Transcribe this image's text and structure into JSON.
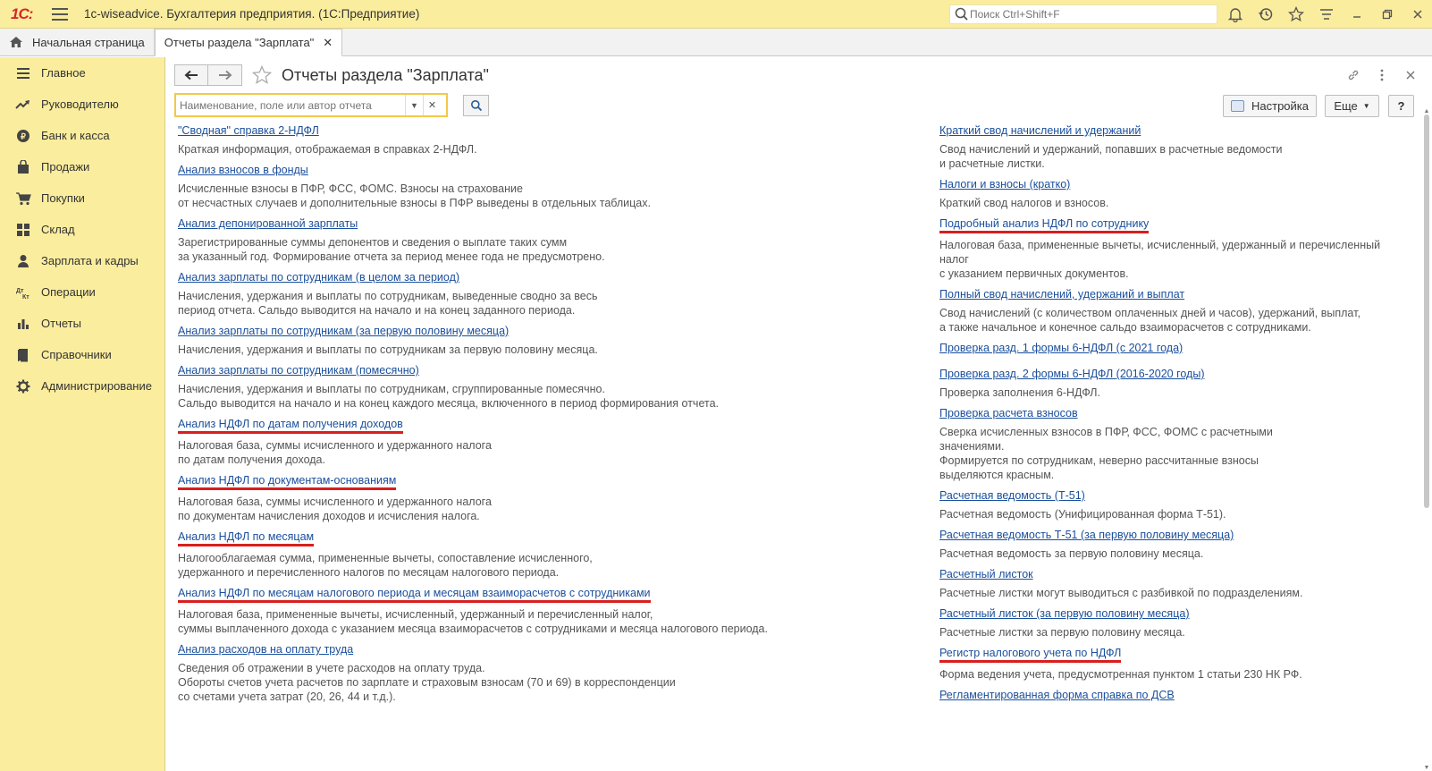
{
  "window": {
    "logo": "1С:",
    "title": "1c-wiseadvice. Бухгалтерия предприятия. (1С:Предприятие)",
    "search_placeholder": "Поиск Ctrl+Shift+F"
  },
  "tabs": [
    {
      "label": "Начальная страница"
    },
    {
      "label": "Отчеты раздела \"Зарплата\""
    }
  ],
  "sidebar": {
    "items": [
      {
        "label": "Главное",
        "icon": "list-icon"
      },
      {
        "label": "Руководителю",
        "icon": "trend-icon"
      },
      {
        "label": "Банк и касса",
        "icon": "coin-icon"
      },
      {
        "label": "Продажи",
        "icon": "bag-icon"
      },
      {
        "label": "Покупки",
        "icon": "cart-icon"
      },
      {
        "label": "Склад",
        "icon": "grid-icon"
      },
      {
        "label": "Зарплата и кадры",
        "icon": "person-icon"
      },
      {
        "label": "Операции",
        "icon": "dt-kt-icon"
      },
      {
        "label": "Отчеты",
        "icon": "bar-chart-icon"
      },
      {
        "label": "Справочники",
        "icon": "book-icon"
      },
      {
        "label": "Администрирование",
        "icon": "gear-icon"
      }
    ]
  },
  "page": {
    "title": "Отчеты раздела \"Зарплата\"",
    "filter_placeholder": "Наименование, поле или автор отчета",
    "settings_label": "Настройка",
    "more_label": "Еще",
    "help_label": "?"
  },
  "reports_left": [
    {
      "name": "\"Сводная\" справка 2-НДФЛ",
      "desc": [
        "Краткая информация, отображаемая в справках 2-НДФЛ."
      ],
      "highlighted": false
    },
    {
      "name": "Анализ взносов в фонды",
      "desc": [
        "Исчисленные взносы в ПФР, ФСС, ФОМС. Взносы на страхование",
        "от несчастных случаев и дополнительные взносы в ПФР выведены в отдельных таблицах."
      ],
      "highlighted": false
    },
    {
      "name": "Анализ депонированной зарплаты",
      "desc": [
        "Зарегистрированные суммы депонентов и сведения о выплате таких сумм",
        "за указанный год. Формирование отчета за период менее года не предусмотрено."
      ],
      "highlighted": false
    },
    {
      "name": "Анализ зарплаты по сотрудникам (в целом за период)",
      "desc": [
        "Начисления, удержания и выплаты по сотрудникам, выведенные сводно за весь",
        "период отчета. Сальдо выводится на начало и на конец заданного периода."
      ],
      "highlighted": false
    },
    {
      "name": "Анализ зарплаты по сотрудникам (за первую половину месяца)",
      "desc": [
        "Начисления, удержания и выплаты по сотрудникам за первую половину месяца."
      ],
      "highlighted": false
    },
    {
      "name": "Анализ зарплаты по сотрудникам (помесячно)",
      "desc": [
        "Начисления, удержания и выплаты по сотрудникам, сгруппированные помесячно.",
        "Сальдо выводится на начало и на конец каждого месяца, включенного в период формирования отчета."
      ],
      "highlighted": false
    },
    {
      "name": "Анализ НДФЛ по датам получения доходов",
      "desc": [
        "Налоговая база, суммы исчисленного и удержанного налога",
        "по датам получения дохода."
      ],
      "highlighted": true
    },
    {
      "name": "Анализ НДФЛ по документам-основаниям",
      "desc": [
        "Налоговая база, суммы исчисленного и удержанного налога",
        "по документам начисления доходов и исчисления налога."
      ],
      "highlighted": true
    },
    {
      "name": "Анализ НДФЛ по месяцам",
      "desc": [
        "Налогооблагаемая сумма, примененные вычеты, сопоставление исчисленного,",
        "удержанного и перечисленного налогов по месяцам налогового периода."
      ],
      "highlighted": true
    },
    {
      "name": "Анализ НДФЛ по месяцам налогового периода и месяцам взаиморасчетов с сотрудниками",
      "desc": [
        "Налоговая база, примененные вычеты, исчисленный, удержанный и перечисленный налог,",
        "суммы выплаченного дохода с указанием месяца взаиморасчетов с сотрудниками и месяца налогового периода."
      ],
      "highlighted": true
    },
    {
      "name": "Анализ расходов на оплату труда",
      "desc": [
        "Сведения об отражении в учете расходов на оплату труда.",
        "Обороты счетов учета расчетов по зарплате и страховым взносам (70 и 69) в корреспонденции",
        "со счетами учета затрат (20, 26, 44 и т.д.)."
      ],
      "highlighted": false
    }
  ],
  "reports_right": [
    {
      "name": "Краткий свод начислений и удержаний",
      "desc": [
        "Свод начислений и удержаний, попавших в расчетные ведомости",
        "и расчетные листки."
      ],
      "highlighted": false
    },
    {
      "name": "Налоги и взносы (кратко)",
      "desc": [
        "Краткий свод налогов и взносов."
      ],
      "highlighted": false
    },
    {
      "name": "Подробный анализ НДФЛ по сотруднику",
      "desc": [
        "Налоговая база, примененные вычеты, исчисленный, удержанный и перечисленный",
        "налог",
        "с указанием первичных документов."
      ],
      "highlighted": true
    },
    {
      "name": "Полный свод начислений, удержаний и выплат",
      "desc": [
        "Свод начислений (с количеством оплаченных дней и часов), удержаний, выплат,",
        "а также начальное и конечное сальдо взаиморасчетов с сотрудниками."
      ],
      "highlighted": false
    },
    {
      "name": "Проверка разд. 1 формы 6-НДФЛ (с 2021 года)",
      "desc": [],
      "highlighted": false
    },
    {
      "name": "Проверка разд. 2 формы 6-НДФЛ (2016-2020 годы)",
      "desc": [
        "Проверка заполнения 6-НДФЛ."
      ],
      "highlighted": false
    },
    {
      "name": "Проверка расчета взносов",
      "desc": [
        "Сверка исчисленных взносов в ПФР, ФСС, ФОМС с расчетными",
        "значениями.",
        "Формируется по сотрудникам, неверно рассчитанные взносы",
        "выделяются красным."
      ],
      "highlighted": false
    },
    {
      "name": "Расчетная ведомость (Т-51)",
      "desc": [
        "Расчетная ведомость (Унифицированная форма Т-51)."
      ],
      "highlighted": false
    },
    {
      "name": "Расчетная ведомость Т-51 (за первую половину месяца)",
      "desc": [
        "Расчетная ведомость за первую половину месяца."
      ],
      "highlighted": false
    },
    {
      "name": "Расчетный листок",
      "desc": [
        "Расчетные листки могут выводиться с разбивкой по подразделениям."
      ],
      "highlighted": false
    },
    {
      "name": "Расчетный листок (за первую половину месяца)",
      "desc": [
        "Расчетные листки за первую половину месяца."
      ],
      "highlighted": false
    },
    {
      "name": "Регистр налогового учета по НДФЛ",
      "desc": [
        "Форма ведения учета, предусмотренная пунктом 1 статьи 230 НК РФ."
      ],
      "highlighted": true
    },
    {
      "name": "Регламентированная форма справка по ДСВ",
      "desc": [],
      "highlighted": false
    }
  ],
  "colors": {
    "accent_yellow": "#fbed9e",
    "link_blue": "#1a4f9c",
    "highlight_red": "#d81e1e",
    "logo_red": "#d7262b"
  }
}
